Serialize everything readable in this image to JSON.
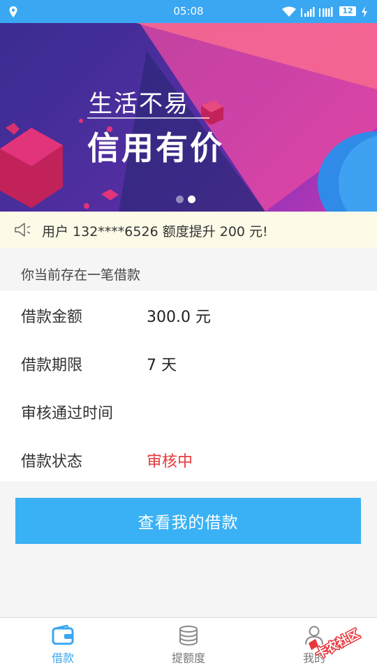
{
  "status_bar": {
    "time": "05:08",
    "battery": "12"
  },
  "banner": {
    "line1": "生活不易",
    "line2": "信用有价",
    "dots": [
      {
        "active": false
      },
      {
        "active": true
      }
    ]
  },
  "notice": {
    "text": "用户 132****6526 额度提升 200 元!"
  },
  "loan": {
    "section_title": "你当前存在一笔借款",
    "rows": [
      {
        "label": "借款金额",
        "value": "300.0 元"
      },
      {
        "label": "借款期限",
        "value": "7 天"
      },
      {
        "label": "审核通过时间",
        "value": ""
      },
      {
        "label": "借款状态",
        "value": "审核中"
      }
    ],
    "status_color": "#e8373a"
  },
  "action_button": {
    "label": "查看我的借款"
  },
  "bottom_nav": {
    "items": [
      {
        "label": "借款",
        "icon": "wallet-icon",
        "active": true
      },
      {
        "label": "提额度",
        "icon": "database-icon",
        "active": false
      },
      {
        "label": "我的",
        "icon": "person-icon",
        "active": false
      }
    ],
    "active_color": "#3aa7f2"
  },
  "watermark": {
    "text": "卡农社区"
  },
  "colors": {
    "accent": "#3aa7f2",
    "button": "#3ab1f4",
    "notice_bg": "#fdfae8"
  }
}
